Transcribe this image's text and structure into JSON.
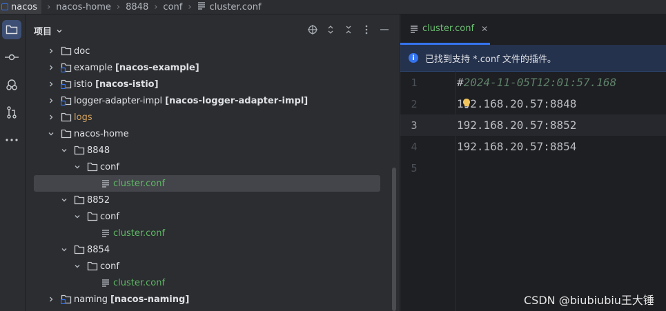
{
  "breadcrumb": {
    "items": [
      "nacos",
      "nacos-home",
      "8848",
      "conf",
      "cluster.conf"
    ]
  },
  "sidebar": {
    "items": [
      "project-icon",
      "commit-icon",
      "git-icon",
      "pull-request-icon",
      "more-icon"
    ]
  },
  "project_panel": {
    "title": "项目",
    "tree": [
      {
        "depth": 1,
        "kind": "folder",
        "expanded": false,
        "label": "doc",
        "module": ""
      },
      {
        "depth": 1,
        "kind": "module",
        "expanded": false,
        "label": "example",
        "module": "[nacos-example]"
      },
      {
        "depth": 1,
        "kind": "module",
        "expanded": false,
        "label": "istio",
        "module": "[nacos-istio]"
      },
      {
        "depth": 1,
        "kind": "module",
        "expanded": false,
        "label": "logger-adapter-impl",
        "module": "[nacos-logger-adapter-impl]"
      },
      {
        "depth": 1,
        "kind": "logs",
        "expanded": false,
        "label": "logs",
        "module": ""
      },
      {
        "depth": 1,
        "kind": "folder",
        "expanded": true,
        "label": "nacos-home",
        "module": ""
      },
      {
        "depth": 2,
        "kind": "folder",
        "expanded": true,
        "label": "8848",
        "module": ""
      },
      {
        "depth": 3,
        "kind": "folder",
        "expanded": true,
        "label": "conf",
        "module": ""
      },
      {
        "depth": 4,
        "kind": "file",
        "expanded": null,
        "label": "cluster.conf",
        "module": "",
        "selected": true
      },
      {
        "depth": 2,
        "kind": "folder",
        "expanded": true,
        "label": "8852",
        "module": ""
      },
      {
        "depth": 3,
        "kind": "folder",
        "expanded": true,
        "label": "conf",
        "module": ""
      },
      {
        "depth": 4,
        "kind": "file",
        "expanded": null,
        "label": "cluster.conf",
        "module": ""
      },
      {
        "depth": 2,
        "kind": "folder",
        "expanded": true,
        "label": "8854",
        "module": ""
      },
      {
        "depth": 3,
        "kind": "folder",
        "expanded": true,
        "label": "conf",
        "module": ""
      },
      {
        "depth": 4,
        "kind": "file",
        "expanded": null,
        "label": "cluster.conf",
        "module": ""
      },
      {
        "depth": 1,
        "kind": "module",
        "expanded": false,
        "label": "naming",
        "module": "[nacos-naming]"
      }
    ]
  },
  "editor": {
    "tab_label": "cluster.conf",
    "banner_text": "已找到支持 *.conf 文件的插件。",
    "lines": [
      {
        "n": "1",
        "text": "#2024-11-05T12:01:57.168",
        "comment": true
      },
      {
        "n": "2",
        "text": "192.168.20.57:8848",
        "comment": false
      },
      {
        "n": "3",
        "text": "192.168.20.57:8852",
        "comment": false,
        "current": true
      },
      {
        "n": "4",
        "text": "192.168.20.57:8854",
        "comment": false
      },
      {
        "n": "5",
        "text": "",
        "comment": false
      }
    ]
  },
  "watermark": "CSDN @biubiubiu王大锤",
  "colors": {
    "accent": "#3574f0",
    "file_green": "#5fb865",
    "logs_orange": "#d4a25e",
    "comment": "#5f826b"
  }
}
